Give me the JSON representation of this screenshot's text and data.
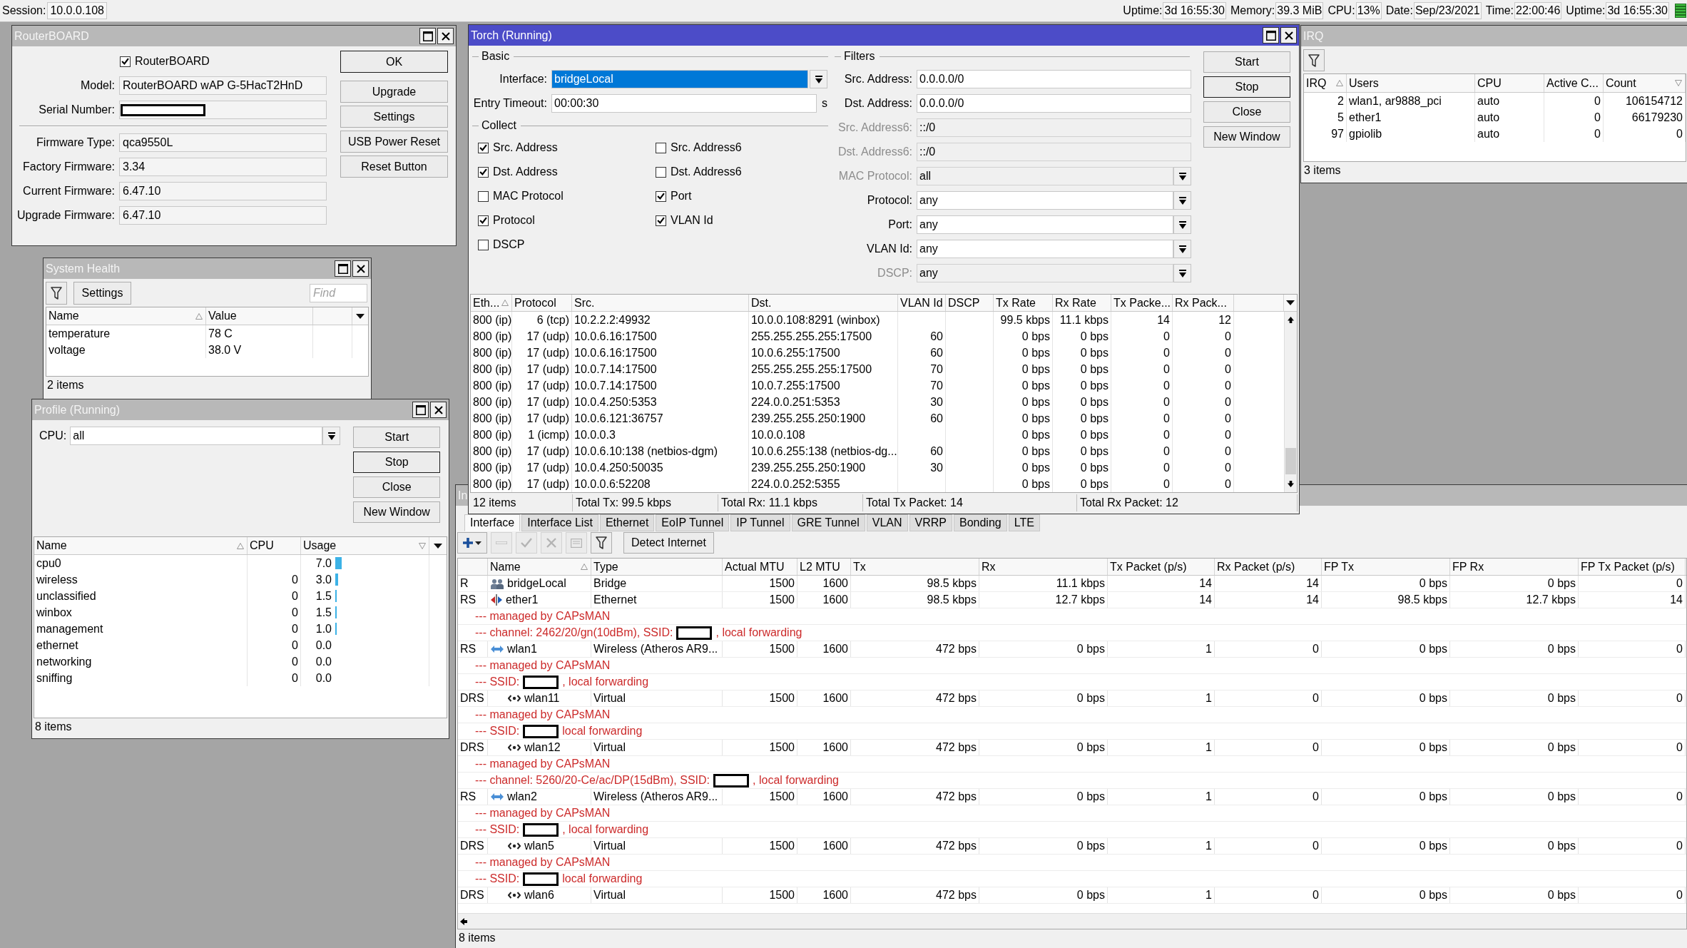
{
  "top_bar": {
    "session_label": "Session:",
    "session_value": "10.0.0.108",
    "stats": [
      {
        "label": "Uptime:",
        "value": "3d 16:55:30"
      },
      {
        "label": "Memory:",
        "value": "39.3 MiB"
      },
      {
        "label": "CPU:",
        "value": "13%"
      },
      {
        "label": "Date:",
        "value": "Sep/23/2021"
      },
      {
        "label": "Time:",
        "value": "22:00:46"
      },
      {
        "label": "Uptime:",
        "value": "3d 16:55:30"
      }
    ]
  },
  "routerboard_window": {
    "title": "RouterBOARD",
    "active": false,
    "routerboard": {
      "label": "RouterBOARD",
      "checked": true
    },
    "fields": [
      {
        "kind": "text",
        "label": "Model:",
        "value": "RouterBOARD wAP G-5HacT2HnD"
      },
      {
        "kind": "redacted",
        "label": "Serial Number:"
      }
    ],
    "firmware_fields": [
      {
        "label": "Firmware Type:",
        "value": "qca9550L"
      },
      {
        "label": "Factory Firmware:",
        "value": "3.34"
      },
      {
        "label": "Current Firmware:",
        "value": "6.47.10"
      },
      {
        "label": "Upgrade Firmware:",
        "value": "6.47.10"
      }
    ],
    "buttons": [
      {
        "label": "OK",
        "default": true
      },
      {
        "label": "Upgrade",
        "default": false
      },
      {
        "label": "Settings",
        "default": false
      },
      {
        "label": "USB Power Reset",
        "default": false
      },
      {
        "label": "Reset Button",
        "default": false
      }
    ]
  },
  "system_health_window": {
    "title": "System Health",
    "active": false,
    "settings_button": "Settings",
    "find_field": {
      "placeholder": "Find"
    },
    "columns": [
      {
        "label": "Name",
        "sorted": true,
        "descending": false
      },
      {
        "label": "Value",
        "sorted": false
      }
    ],
    "rows": [
      {
        "name": "temperature",
        "value": "78 C"
      },
      {
        "name": "voltage",
        "value": "38.0 V"
      }
    ],
    "status": "2 items"
  },
  "profile_window": {
    "title": "Profile (Running)",
    "active": false,
    "cpu": {
      "label": "CPU:",
      "value": "all"
    },
    "buttons": [
      {
        "label": "Start",
        "default": false
      },
      {
        "label": "Stop",
        "default": true
      },
      {
        "label": "Close",
        "default": false
      },
      {
        "label": "New Window",
        "default": false
      }
    ],
    "columns": [
      {
        "label": "Name",
        "sorted": true,
        "descending": false
      },
      {
        "label": "CPU",
        "sorted": false
      },
      {
        "label": "Usage",
        "sorted": true,
        "descending": true
      }
    ],
    "rows": [
      {
        "name": "cpu0",
        "usage": "7.0",
        "level": 0.07
      },
      {
        "name": "wireless",
        "cpu": "0",
        "usage": "3.0",
        "level": 0.03
      },
      {
        "name": "unclassified",
        "cpu": "0",
        "usage": "1.5",
        "level": 0.015
      },
      {
        "name": "winbox",
        "cpu": "0",
        "usage": "1.5",
        "level": 0.015
      },
      {
        "name": "management",
        "cpu": "0",
        "usage": "1.0",
        "level": 0.01
      },
      {
        "name": "ethernet",
        "cpu": "0",
        "usage": "0.0"
      },
      {
        "name": "networking",
        "cpu": "0",
        "usage": "0.0"
      },
      {
        "name": "sniffing",
        "cpu": "0",
        "usage": "0.0"
      }
    ],
    "status": "8 items"
  },
  "torch_window": {
    "title": "Torch (Running)",
    "active": true,
    "basic": {
      "heading": "Basic",
      "interface": {
        "label": "Interface:",
        "value": "bridgeLocal",
        "selected": true
      },
      "entry_timeout": {
        "label": "Entry Timeout:",
        "value": "00:00:30",
        "unit": "s"
      }
    },
    "collect": {
      "heading": "Collect",
      "checkboxes": [
        {
          "label": "Src. Address",
          "checked": true
        },
        {
          "label": "Src. Address6",
          "checked": false
        },
        {
          "label": "Dst. Address",
          "checked": true
        },
        {
          "label": "Dst. Address6",
          "checked": false
        },
        {
          "label": "MAC Protocol",
          "checked": false
        },
        {
          "label": "Port",
          "checked": true
        },
        {
          "label": "Protocol",
          "checked": true
        },
        {
          "label": "VLAN Id",
          "checked": true
        },
        {
          "label": "DSCP",
          "checked": false
        }
      ]
    },
    "filters": {
      "heading": "Filters",
      "fields": [
        {
          "kind": "text",
          "label": "Src. Address:",
          "value": "0.0.0.0/0",
          "disabled": false
        },
        {
          "kind": "text",
          "label": "Dst. Address:",
          "value": "0.0.0.0/0",
          "disabled": false
        },
        {
          "kind": "text",
          "label": "Src. Address6:",
          "value": "::/0",
          "disabled": true
        },
        {
          "kind": "text",
          "label": "Dst. Address6:",
          "value": "::/0",
          "disabled": true
        },
        {
          "kind": "dropdown",
          "label": "MAC Protocol:",
          "value": "all",
          "disabled": true
        },
        {
          "kind": "dropdown",
          "label": "Protocol:",
          "value": "any",
          "disabled": false
        },
        {
          "kind": "dropdown",
          "label": "Port:",
          "value": "any",
          "disabled": false
        },
        {
          "kind": "dropdown",
          "label": "VLAN Id:",
          "value": "any",
          "disabled": false
        },
        {
          "kind": "dropdown",
          "label": "DSCP:",
          "value": "any",
          "disabled": true
        }
      ]
    },
    "buttons": [
      {
        "label": "Start",
        "default": false
      },
      {
        "label": "Stop",
        "default": true
      },
      {
        "label": "Close",
        "default": false
      },
      {
        "label": "New Window",
        "default": false
      }
    ],
    "columns": [
      {
        "label": "Eth...",
        "sorted": true,
        "descending": false
      },
      {
        "label": "Protocol",
        "sorted": false
      },
      {
        "label": "Src.",
        "sorted": false
      },
      {
        "label": "Dst.",
        "sorted": false
      },
      {
        "label": "VLAN Id",
        "sorted": false
      },
      {
        "label": "DSCP",
        "sorted": false
      },
      {
        "label": "Tx Rate",
        "sorted": false
      },
      {
        "label": "Rx Rate",
        "sorted": false
      },
      {
        "label": "Tx Packe...",
        "sorted": false
      },
      {
        "label": "Rx Pack...",
        "sorted": false
      }
    ],
    "rows": [
      {
        "eth": "800 (ip)",
        "protocol": "6 (tcp)",
        "src": "10.2.2.2:49932",
        "dst": "10.0.0.108:8291 (winbox)",
        "tx_rate": "99.5 kbps",
        "rx_rate": "11.1 kbps",
        "tx_packets": "14",
        "rx_packets": "12"
      },
      {
        "eth": "800 (ip)",
        "protocol": "17 (udp)",
        "src": "10.0.6.16:17500",
        "dst": "255.255.255.255:17500",
        "vlan_id": "60",
        "tx_rate": "0 bps",
        "rx_rate": "0 bps",
        "tx_packets": "0",
        "rx_packets": "0"
      },
      {
        "eth": "800 (ip)",
        "protocol": "17 (udp)",
        "src": "10.0.6.16:17500",
        "dst": "10.0.6.255:17500",
        "vlan_id": "60",
        "tx_rate": "0 bps",
        "rx_rate": "0 bps",
        "tx_packets": "0",
        "rx_packets": "0"
      },
      {
        "eth": "800 (ip)",
        "protocol": "17 (udp)",
        "src": "10.0.7.14:17500",
        "dst": "255.255.255.255:17500",
        "vlan_id": "70",
        "tx_rate": "0 bps",
        "rx_rate": "0 bps",
        "tx_packets": "0",
        "rx_packets": "0"
      },
      {
        "eth": "800 (ip)",
        "protocol": "17 (udp)",
        "src": "10.0.7.14:17500",
        "dst": "10.0.7.255:17500",
        "vlan_id": "70",
        "tx_rate": "0 bps",
        "rx_rate": "0 bps",
        "tx_packets": "0",
        "rx_packets": "0"
      },
      {
        "eth": "800 (ip)",
        "protocol": "17 (udp)",
        "src": "10.0.4.250:5353",
        "dst": "224.0.0.251:5353",
        "vlan_id": "30",
        "tx_rate": "0 bps",
        "rx_rate": "0 bps",
        "tx_packets": "0",
        "rx_packets": "0"
      },
      {
        "eth": "800 (ip)",
        "protocol": "17 (udp)",
        "src": "10.0.6.121:36757",
        "dst": "239.255.255.250:1900",
        "vlan_id": "60",
        "tx_rate": "0 bps",
        "rx_rate": "0 bps",
        "tx_packets": "0",
        "rx_packets": "0"
      },
      {
        "eth": "800 (ip)",
        "protocol": "1 (icmp)",
        "src": "10.0.0.3",
        "dst": "10.0.0.108",
        "tx_rate": "0 bps",
        "rx_rate": "0 bps",
        "tx_packets": "0",
        "rx_packets": "0"
      },
      {
        "eth": "800 (ip)",
        "protocol": "17 (udp)",
        "src": "10.0.6.10:138 (netbios-dgm)",
        "dst": "10.0.6.255:138 (netbios-dg...",
        "vlan_id": "60",
        "tx_rate": "0 bps",
        "rx_rate": "0 bps",
        "tx_packets": "0",
        "rx_packets": "0"
      },
      {
        "eth": "800 (ip)",
        "protocol": "17 (udp)",
        "src": "10.0.4.250:50035",
        "dst": "239.255.255.250:1900",
        "vlan_id": "30",
        "tx_rate": "0 bps",
        "rx_rate": "0 bps",
        "tx_packets": "0",
        "rx_packets": "0"
      },
      {
        "eth": "800 (ip)",
        "protocol": "17 (udp)",
        "src": "10.0.0.6:52208",
        "dst": "224.0.0.252:5355",
        "tx_rate": "0 bps",
        "rx_rate": "0 bps",
        "tx_packets": "0",
        "rx_packets": "0"
      }
    ],
    "status": [
      "12 items",
      "Total Tx: 99.5 kbps",
      "Total Rx: 11.1 kbps",
      "Total Tx Packet: 14",
      "Total Rx Packet: 12"
    ]
  },
  "irq_window": {
    "title": "IRQ",
    "active": false,
    "columns": [
      {
        "label": "IRQ",
        "sorted": true,
        "descending": false
      },
      {
        "label": "Users",
        "sorted": false
      },
      {
        "label": "CPU",
        "sorted": false
      },
      {
        "label": "Active C...",
        "sorted": false
      },
      {
        "label": "Count",
        "sorted": true,
        "descending": true
      }
    ],
    "rows": [
      {
        "irq": "2",
        "users": "wlan1, ar9888_pci",
        "cpu": "auto",
        "active_cpu": "0",
        "count": "106154712"
      },
      {
        "irq": "5",
        "users": "ether1",
        "cpu": "auto",
        "active_cpu": "0",
        "count": "66179230"
      },
      {
        "irq": "97",
        "users": "gpiolib",
        "cpu": "auto",
        "active_cpu": "0",
        "count": "0"
      }
    ],
    "status": "3 items"
  },
  "interface_window": {
    "title": "In",
    "active": false,
    "tabs": [
      {
        "label": "Interface",
        "selected": true
      },
      {
        "label": "Interface List",
        "selected": false
      },
      {
        "label": "Ethernet",
        "selected": false
      },
      {
        "label": "EoIP Tunnel",
        "selected": false
      },
      {
        "label": "IP Tunnel",
        "selected": false
      },
      {
        "label": "GRE Tunnel",
        "selected": false
      },
      {
        "label": "VLAN",
        "selected": false
      },
      {
        "label": "VRRP",
        "selected": false
      },
      {
        "label": "Bonding",
        "selected": false
      },
      {
        "label": "LTE",
        "selected": false
      }
    ],
    "toolbar": [
      {
        "kind": "add",
        "disabled": false
      },
      {
        "kind": "remove",
        "disabled": true
      },
      {
        "kind": "enable",
        "disabled": true
      },
      {
        "kind": "disable",
        "disabled": true
      },
      {
        "kind": "comment",
        "disabled": true
      },
      {
        "kind": "filter",
        "disabled": false
      }
    ],
    "detect_button": "Detect Internet",
    "columns": [
      {
        "label": "Name",
        "sorted": true,
        "descending": false
      },
      {
        "label": "Type",
        "sorted": false
      },
      {
        "label": "Actual MTU",
        "sorted": false
      },
      {
        "label": "L2 MTU",
        "sorted": false
      },
      {
        "label": "Tx",
        "sorted": false
      },
      {
        "label": "Rx",
        "sorted": false
      },
      {
        "label": "Tx Packet (p/s)",
        "sorted": false
      },
      {
        "label": "Rx Packet (p/s)",
        "sorted": false
      },
      {
        "label": "FP Tx",
        "sorted": false
      },
      {
        "label": "FP Rx",
        "sorted": false
      },
      {
        "label": "FP Tx Packet (p/s)",
        "sorted": false
      }
    ],
    "rows": [
      {
        "kind": "bridge",
        "flags": "R",
        "name": "bridgeLocal",
        "type": "Bridge",
        "actual_mtu": "1500",
        "l2_mtu": "1600",
        "tx": "98.5 kbps",
        "rx": "11.1 kbps",
        "tx_packet": "14",
        "rx_packet": "14",
        "fp_tx": "0 bps",
        "fp_rx": "0 bps",
        "fp_tx_packet": "0"
      },
      {
        "kind": "ethernet",
        "flags": "RS",
        "name": "ether1",
        "type": "Ethernet",
        "actual_mtu": "1500",
        "l2_mtu": "1600",
        "tx": "98.5 kbps",
        "rx": "12.7 kbps",
        "tx_packet": "14",
        "rx_packet": "14",
        "fp_tx": "98.5 kbps",
        "fp_rx": "12.7 kbps",
        "fp_tx_packet": "14"
      },
      {
        "kind": "comment",
        "text": "--- managed by CAPsMAN",
        "redacted": false
      },
      {
        "kind": "comment",
        "text": "--- channel: 2462/20/gn(10dBm), SSID:",
        "redacted": true,
        "text_after": ", local forwarding"
      },
      {
        "kind": "wireless",
        "flags": "RS",
        "name": "wlan1",
        "type": "Wireless (Atheros AR9...",
        "actual_mtu": "1500",
        "l2_mtu": "1600",
        "tx": "472 bps",
        "rx": "0 bps",
        "tx_packet": "1",
        "rx_packet": "0",
        "fp_tx": "0 bps",
        "fp_rx": "0 bps",
        "fp_tx_packet": "0"
      },
      {
        "kind": "comment",
        "text": "--- managed by CAPsMAN",
        "redacted": false
      },
      {
        "kind": "comment",
        "text": "--- SSID:",
        "redacted": true,
        "text_after": ", local forwarding"
      },
      {
        "kind": "virtual",
        "flags": "DRS",
        "name": "wlan11",
        "type": "Virtual",
        "actual_mtu": "1500",
        "l2_mtu": "1600",
        "tx": "472 bps",
        "rx": "0 bps",
        "tx_packet": "1",
        "rx_packet": "0",
        "fp_tx": "0 bps",
        "fp_rx": "0 bps",
        "fp_tx_packet": "0"
      },
      {
        "kind": "comment",
        "text": "--- managed by CAPsMAN",
        "redacted": false
      },
      {
        "kind": "comment",
        "text": "--- SSID:",
        "redacted": true,
        "text_after": "local forwarding"
      },
      {
        "kind": "virtual",
        "flags": "DRS",
        "name": "wlan12",
        "type": "Virtual",
        "actual_mtu": "1500",
        "l2_mtu": "1600",
        "tx": "472 bps",
        "rx": "0 bps",
        "tx_packet": "1",
        "rx_packet": "0",
        "fp_tx": "0 bps",
        "fp_rx": "0 bps",
        "fp_tx_packet": "0"
      },
      {
        "kind": "comment",
        "text": "--- managed by CAPsMAN",
        "redacted": false
      },
      {
        "kind": "comment",
        "text": "--- channel: 5260/20-Ce/ac/DP(15dBm), SSID:",
        "redacted": true,
        "text_after": ", local forwarding"
      },
      {
        "kind": "wireless",
        "flags": "RS",
        "name": "wlan2",
        "type": "Wireless (Atheros AR9...",
        "actual_mtu": "1500",
        "l2_mtu": "1600",
        "tx": "472 bps",
        "rx": "0 bps",
        "tx_packet": "1",
        "rx_packet": "0",
        "fp_tx": "0 bps",
        "fp_rx": "0 bps",
        "fp_tx_packet": "0"
      },
      {
        "kind": "comment",
        "text": "--- managed by CAPsMAN",
        "redacted": false
      },
      {
        "kind": "comment",
        "text": "--- SSID:",
        "redacted": true,
        "text_after": ", local forwarding"
      },
      {
        "kind": "virtual",
        "flags": "DRS",
        "name": "wlan5",
        "type": "Virtual",
        "actual_mtu": "1500",
        "l2_mtu": "1600",
        "tx": "472 bps",
        "rx": "0 bps",
        "tx_packet": "1",
        "rx_packet": "0",
        "fp_tx": "0 bps",
        "fp_rx": "0 bps",
        "fp_tx_packet": "0"
      },
      {
        "kind": "comment",
        "text": "--- managed by CAPsMAN",
        "redacted": false
      },
      {
        "kind": "comment",
        "text": "--- SSID:",
        "redacted": true,
        "text_after": "local forwarding"
      },
      {
        "kind": "virtual",
        "flags": "DRS",
        "name": "wlan6",
        "type": "Virtual",
        "actual_mtu": "1500",
        "l2_mtu": "1600",
        "tx": "472 bps",
        "rx": "0 bps",
        "tx_packet": "1",
        "rx_packet": "0",
        "fp_tx": "0 bps",
        "fp_rx": "0 bps",
        "fp_tx_packet": "0"
      }
    ],
    "status": "8 items"
  }
}
